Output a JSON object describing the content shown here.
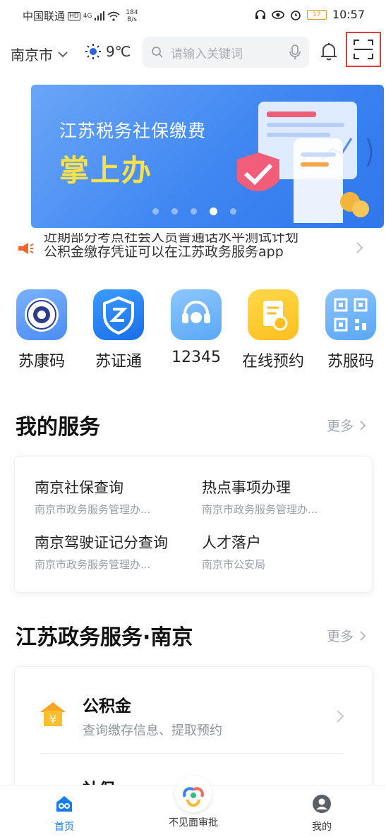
{
  "status_bar": {
    "carrier": "中国联通",
    "hd": "HD",
    "network": "4G",
    "speed_value": "184",
    "speed_unit": "B/s",
    "battery": "17",
    "time": "10:57"
  },
  "header": {
    "city": "南京市",
    "temperature": "9℃",
    "search_placeholder": "请输入关键词"
  },
  "banner": {
    "title": "江苏税务社保缴费",
    "headline": "掌上办",
    "active_dot": 3,
    "dot_count": 5
  },
  "notice": {
    "line1": "近期部分考点社会人员普通话水平测试计划",
    "line2": "公积金缴存凭证可以在江苏政务服务app"
  },
  "quick_links": [
    {
      "label": "苏康码",
      "icon": "sukang-emblem-icon"
    },
    {
      "label": "苏证通",
      "icon": "suzheng-shield-icon"
    },
    {
      "label": "12345",
      "icon": "hotline-headset-icon"
    },
    {
      "label": "在线预约",
      "icon": "appointment-doc-icon"
    },
    {
      "label": "苏服码",
      "icon": "qr-code-icon"
    }
  ],
  "my_services": {
    "title": "我的服务",
    "more": "更多",
    "items": [
      {
        "name": "南京社保查询",
        "dept": "南京市政务服务管理办..."
      },
      {
        "name": "热点事项办理",
        "dept": "南京市政务服务管理办..."
      },
      {
        "name": "南京驾驶证记分查询",
        "dept": "南京市政务服务管理办..."
      },
      {
        "name": "人才落户",
        "dept": "南京市公安局"
      }
    ]
  },
  "gov_services": {
    "title": "江苏政务服务·南京",
    "more": "更多",
    "items": [
      {
        "title": "公积金",
        "sub": "查询缴存信息、提取预约",
        "icon": "house-yuan-icon"
      },
      {
        "title": "社保",
        "sub": "",
        "icon": "social-security-icon"
      }
    ]
  },
  "bottom_nav": [
    {
      "label": "首页",
      "icon": "home-logo-icon",
      "active": true
    },
    {
      "label": "不见面审批",
      "icon": "center-logo-icon",
      "active": false
    },
    {
      "label": "我的",
      "icon": "user-avatar-icon",
      "active": false
    }
  ],
  "colors": {
    "accent": "#1a7cf0",
    "scan_highlight": "#e23b3b",
    "banner_headline": "#ffe14a",
    "notice_icon": "#f0662b"
  }
}
